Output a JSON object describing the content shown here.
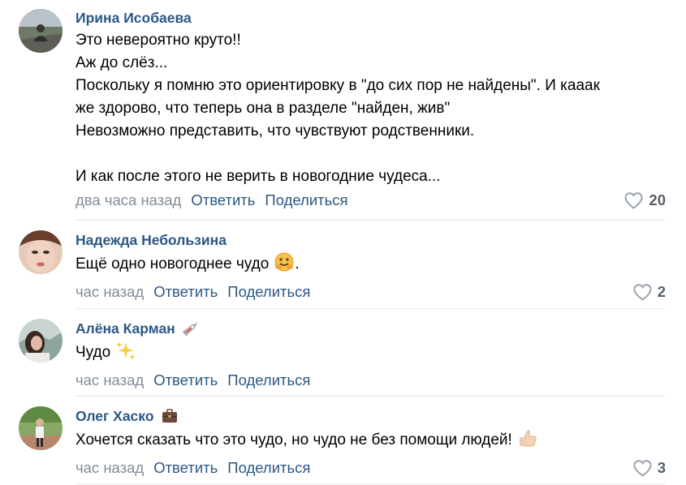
{
  "accent_color": "#2a5885",
  "comments": [
    {
      "author": "Ирина Исобаева",
      "text_lines": [
        "Это невероятно круто!!",
        "Аж до слёз...",
        "Поскольку я помню это ориентировку в \"до сих пор не найдены\". И кааак",
        "же здорово, что теперь она в разделе \"найден, жив\"",
        "Невозможно представить, что чувствуют родственники.",
        "",
        "И как после этого не верить в новогодние чудеса..."
      ],
      "time": "два часа назад",
      "reply": "Ответить",
      "share": "Поделиться",
      "likes": "20"
    },
    {
      "author": "Надежда Небользина",
      "text_lines": [
        "Ещё одно новогоднее чудо"
      ],
      "text_suffix": ".",
      "emoji": "hugging-face-icon",
      "time": "час назад",
      "reply": "Ответить",
      "share": "Поделиться",
      "likes": "2"
    },
    {
      "author": "Алёна Карман",
      "author_badge": "syringe-icon",
      "text_lines": [
        "Чудо"
      ],
      "emoji": "sparkles-icon",
      "time": "час назад",
      "reply": "Ответить",
      "share": "Поделиться",
      "likes": ""
    },
    {
      "author": "Олег Хаско",
      "author_badge": "briefcase-icon",
      "text_lines": [
        "Хочется сказать что это чудо, но чудо не без помощи людей!"
      ],
      "emoji": "thumbs-up-icon",
      "time": "час назад",
      "reply": "Ответить",
      "share": "Поделиться",
      "likes": "3"
    }
  ]
}
